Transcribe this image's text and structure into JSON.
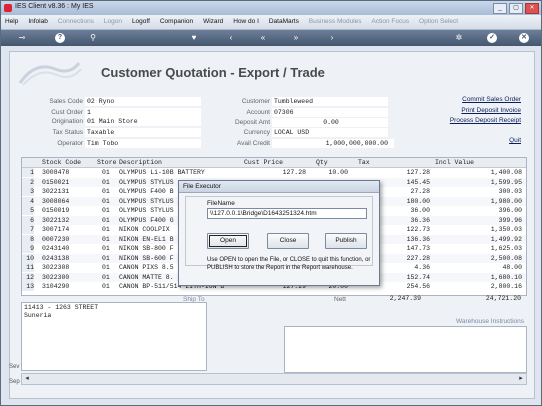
{
  "window": {
    "title": "IES Client v8.36 : My IES"
  },
  "menu": [
    {
      "label": "Help",
      "enabled": true
    },
    {
      "label": "Infolab",
      "enabled": true
    },
    {
      "label": "Connections",
      "enabled": false
    },
    {
      "label": "Logon",
      "enabled": false
    },
    {
      "label": "Logoff",
      "enabled": true
    },
    {
      "label": "Companion",
      "enabled": true
    },
    {
      "label": "Wizard",
      "enabled": true
    },
    {
      "label": "How do I",
      "enabled": true
    },
    {
      "label": "DataMarts",
      "enabled": true
    },
    {
      "label": "Business Modules",
      "enabled": false
    },
    {
      "label": "Action Focus",
      "enabled": false
    },
    {
      "label": "Option Select",
      "enabled": false
    }
  ],
  "toolbar_icons": [
    "key-icon",
    "help-icon",
    "search-icon",
    "heart-icon",
    "back-icon",
    "rewind-icon",
    "forward-icon",
    "end-icon",
    "settings-icon",
    "check-icon",
    "close-icon"
  ],
  "page": {
    "title": "Customer Quotation - Export / Trade"
  },
  "header": {
    "sales_code": {
      "label": "Sales Code",
      "value": "02 Ryno"
    },
    "cust_order": {
      "label": "Cust Order",
      "value": "1"
    },
    "origination": {
      "label": "Origination",
      "value": "01 Main Store"
    },
    "tax_status": {
      "label": "Tax Status",
      "value": "Taxable"
    },
    "operator": {
      "label": "Operator",
      "value": "Tim Tobo"
    },
    "customer": {
      "label": "Customer",
      "value": "Tumbleweed"
    },
    "account": {
      "label": "Account",
      "value": "07306"
    },
    "deposit_amt": {
      "label": "Deposit Amt",
      "value": "0.00"
    },
    "currency": {
      "label": "Currency",
      "value": "LOCAL USD"
    },
    "avail_credit": {
      "label": "Avail Credit",
      "value": "1,000,000,000.00"
    }
  },
  "links": {
    "commit": "Commit Sales Order",
    "print_invoice": "Print Deposit Invoice",
    "process_receipt": "Process Deposit Receipt",
    "quit": "Quit"
  },
  "grid": {
    "columns": {
      "stock_code": "Stock Code",
      "store": "Store",
      "description": "Description",
      "cust_price": "Cust Price",
      "qty": "Qty",
      "tax": "Tax",
      "incl_value": "Incl Value"
    },
    "rows": [
      {
        "n": "1",
        "stock_code": "3008478",
        "store": "01",
        "description": "OLYMPUS Li-10B BATTERY",
        "cust_price": "127.28",
        "qty": "10.00",
        "tax": "127.28",
        "incl_value": "1,400.08"
      },
      {
        "n": "2",
        "stock_code": "0150021",
        "store": "01",
        "description": "OLYMPUS STYLUS",
        "cust_price": "",
        "qty": "",
        "tax": "145.45",
        "incl_value": "1,599.95"
      },
      {
        "n": "3",
        "stock_code": "3022131",
        "store": "01",
        "description": "OLYMPUS F400 B",
        "cust_price": "",
        "qty": "",
        "tax": "27.28",
        "incl_value": "300.03"
      },
      {
        "n": "4",
        "stock_code": "3008064",
        "store": "01",
        "description": "OLYMPUS STYLUS",
        "cust_price": "",
        "qty": "",
        "tax": "180.00",
        "incl_value": "1,980.00"
      },
      {
        "n": "5",
        "stock_code": "0150019",
        "store": "01",
        "description": "OLYMPUS STYLUS",
        "cust_price": "",
        "qty": "",
        "tax": "36.00",
        "incl_value": "396.00"
      },
      {
        "n": "6",
        "stock_code": "3022132",
        "store": "01",
        "description": "OLYMPUS F400 G",
        "cust_price": "",
        "qty": "",
        "tax": "36.36",
        "incl_value": "399.96"
      },
      {
        "n": "7",
        "stock_code": "3007174",
        "store": "01",
        "description": "NIKON COOLPIX",
        "cust_price": "",
        "qty": "",
        "tax": "122.73",
        "incl_value": "1,350.03"
      },
      {
        "n": "8",
        "stock_code": "0007230",
        "store": "01",
        "description": "NIKON EN-EL1 B",
        "cust_price": "",
        "qty": "",
        "tax": "136.36",
        "incl_value": "1,499.92"
      },
      {
        "n": "9",
        "stock_code": "0243140",
        "store": "01",
        "description": "NIKON SB-800 F",
        "cust_price": "",
        "qty": "",
        "tax": "147.73",
        "incl_value": "1,625.03"
      },
      {
        "n": "10",
        "stock_code": "0243138",
        "store": "01",
        "description": "NIKON SB-600 F",
        "cust_price": "",
        "qty": "",
        "tax": "227.28",
        "incl_value": "2,500.08"
      },
      {
        "n": "11",
        "stock_code": "3022308",
        "store": "01",
        "description": "CANON PIXS 8.5",
        "cust_price": "",
        "qty": "",
        "tax": "4.36",
        "incl_value": "48.00"
      },
      {
        "n": "12",
        "stock_code": "3022300",
        "store": "01",
        "description": "CANON MATTE 8.",
        "cust_price": "",
        "qty": "",
        "tax": "152.74",
        "incl_value": "1,680.10"
      },
      {
        "n": "13",
        "stock_code": "3104290",
        "store": "01",
        "description": "CANON BP-511/514 LITH-ION B",
        "cust_price": "127.29",
        "qty": "20.00",
        "tax": "254.56",
        "incl_value": "2,800.16"
      }
    ]
  },
  "footer": {
    "ship_to_label": "Ship To",
    "nett_label": "Nett",
    "tax_total": "2,247.39",
    "incl_total": "24,721.20",
    "address_lines": [
      "11413 - 1263 STREET",
      "Suneria"
    ],
    "warehouse_label": "Warehouse Instructions",
    "side_sev": "Sev",
    "side_sep": "Sep"
  },
  "dialog": {
    "title": "File Executor",
    "filename_label": "FileName",
    "filename_value": "\\\\127.0.0.1\\Bridge\\D1643251324.htm",
    "buttons": {
      "open": "Open",
      "close": "Close",
      "publish": "Publish"
    },
    "help": "Use OPEN to open the File, or CLOSE to quit this function, or PUBLISH to store the Report in the Report warehouse."
  }
}
